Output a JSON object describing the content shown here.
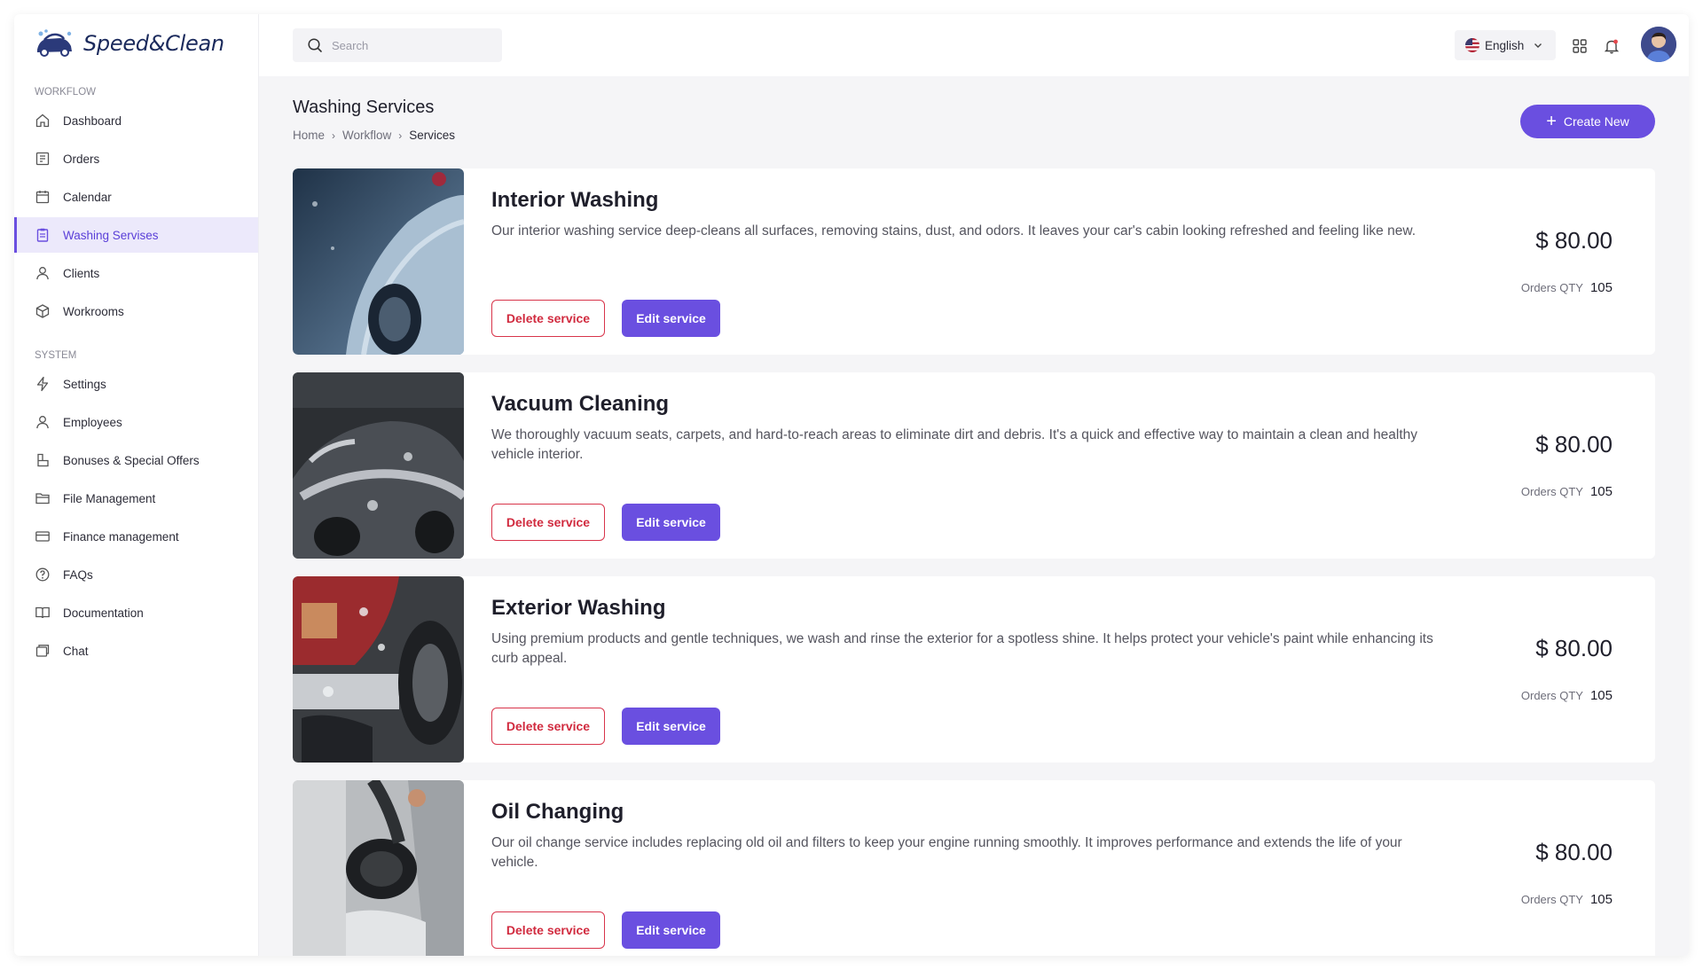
{
  "brand": {
    "name": "Speed&Clean"
  },
  "sidebar": {
    "workflow_title": "WORKFLOW",
    "system_title": "SYSTEM",
    "workflow_items": [
      {
        "label": "Dashboard",
        "icon": "home-icon"
      },
      {
        "label": "Orders",
        "icon": "orders-icon"
      },
      {
        "label": "Calendar",
        "icon": "calendar-icon"
      },
      {
        "label": "Washing Servises",
        "icon": "clipboard-icon",
        "active": true
      },
      {
        "label": "Clients",
        "icon": "user-icon"
      },
      {
        "label": "Workrooms",
        "icon": "cube-icon"
      }
    ],
    "system_items": [
      {
        "label": "Settings",
        "icon": "lightning-icon"
      },
      {
        "label": "Employees",
        "icon": "user-icon"
      },
      {
        "label": "Bonuses & Special Offers",
        "icon": "gift-icon"
      },
      {
        "label": "File Management",
        "icon": "folder-icon"
      },
      {
        "label": "Finance management",
        "icon": "card-icon"
      },
      {
        "label": "FAQs",
        "icon": "help-icon"
      },
      {
        "label": "Documentation",
        "icon": "book-icon"
      },
      {
        "label": "Chat",
        "icon": "chat-icon"
      }
    ]
  },
  "topbar": {
    "search_placeholder": "Search",
    "language": "English"
  },
  "page": {
    "title": "Washing Services",
    "breadcrumb": [
      "Home",
      "Workflow",
      "Services"
    ],
    "create_label": "Create New"
  },
  "services": [
    {
      "title": "Interior Washing",
      "description": "Our interior washing service deep-cleans all surfaces, removing stains, dust, and odors. It leaves your car's cabin looking refreshed and feeling like new.",
      "price": "$ 80.00",
      "qty_label": "Orders QTY",
      "qty": "105",
      "delete_label": "Delete service",
      "edit_label": "Edit service"
    },
    {
      "title": "Vacuum Cleaning",
      "description": "We thoroughly vacuum seats, carpets, and hard-to-reach areas to eliminate dirt and debris. It's a quick and effective way to maintain a clean and healthy vehicle interior.",
      "price": "$ 80.00",
      "qty_label": "Orders QTY",
      "qty": "105",
      "delete_label": "Delete service",
      "edit_label": "Edit service"
    },
    {
      "title": "Exterior Washing",
      "description": "Using premium products and gentle techniques, we wash and rinse the exterior for a spotless shine. It helps protect your vehicle's paint while enhancing its curb appeal.",
      "price": "$ 80.00",
      "qty_label": "Orders QTY",
      "qty": "105",
      "delete_label": "Delete service",
      "edit_label": "Edit service"
    },
    {
      "title": "Oil Changing",
      "description": "Our oil change service includes replacing old oil and filters to keep your engine running smoothly. It improves performance and extends the life of your vehicle.",
      "price": "$ 80.00",
      "qty_label": "Orders QTY",
      "qty": "105",
      "delete_label": "Delete service",
      "edit_label": "Edit service"
    }
  ],
  "colors": {
    "accent": "#6a4fe0",
    "danger": "#d12b3f",
    "active_bg": "#ece9fb"
  }
}
